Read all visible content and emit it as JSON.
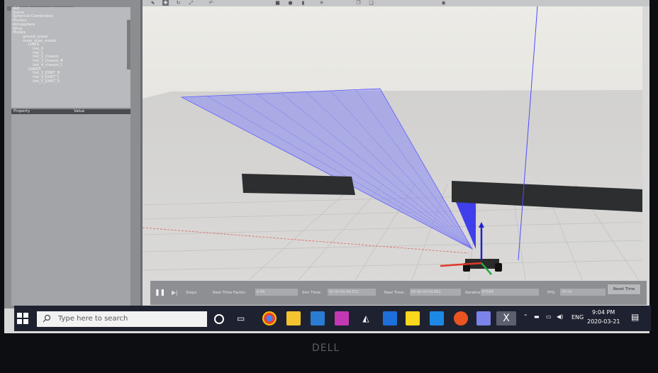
{
  "tree": {
    "items": [
      "GUI",
      "Scene",
      "Spherical Coordinates",
      "Physics",
      "Atmosphere",
      "Wind",
      "Models",
      "ground_plane",
      "rover_scan_model",
      "LINKS",
      "link_0",
      "link_1",
      "link_2_chassis",
      "link_3_chassis_B",
      "link_4_chassis_C",
      "JOINTS",
      "link_3_JOINT_B",
      "link_4_JOINT_C",
      "link_5_JOINT_D"
    ]
  },
  "properties": {
    "col_property": "Property",
    "col_value": "Value"
  },
  "simbar": {
    "steps_label": "Steps",
    "rtf_label": "Real Time Factor:",
    "rtf_value": "0.99",
    "simtime_label": "Sim Time:",
    "simtime_value": "00 00:03:44.372",
    "realtime_label": "Real Time:",
    "realtime_value": "00 00:03:54.852",
    "iterations_label": "Iterations:",
    "iterations_value": "87569",
    "fps_label": "FPS:",
    "fps_value": "24.54",
    "reset_label": "Reset Time"
  },
  "taskbar": {
    "search_placeholder": "Type here to search",
    "language": "ENG",
    "time": "9:04 PM",
    "date": "2020-03-21"
  },
  "bezel": {
    "brand": "DELL"
  },
  "colors": {
    "laser": "#7b7bff",
    "wall": "#2d2e30",
    "taskbar": "#1e2230"
  }
}
